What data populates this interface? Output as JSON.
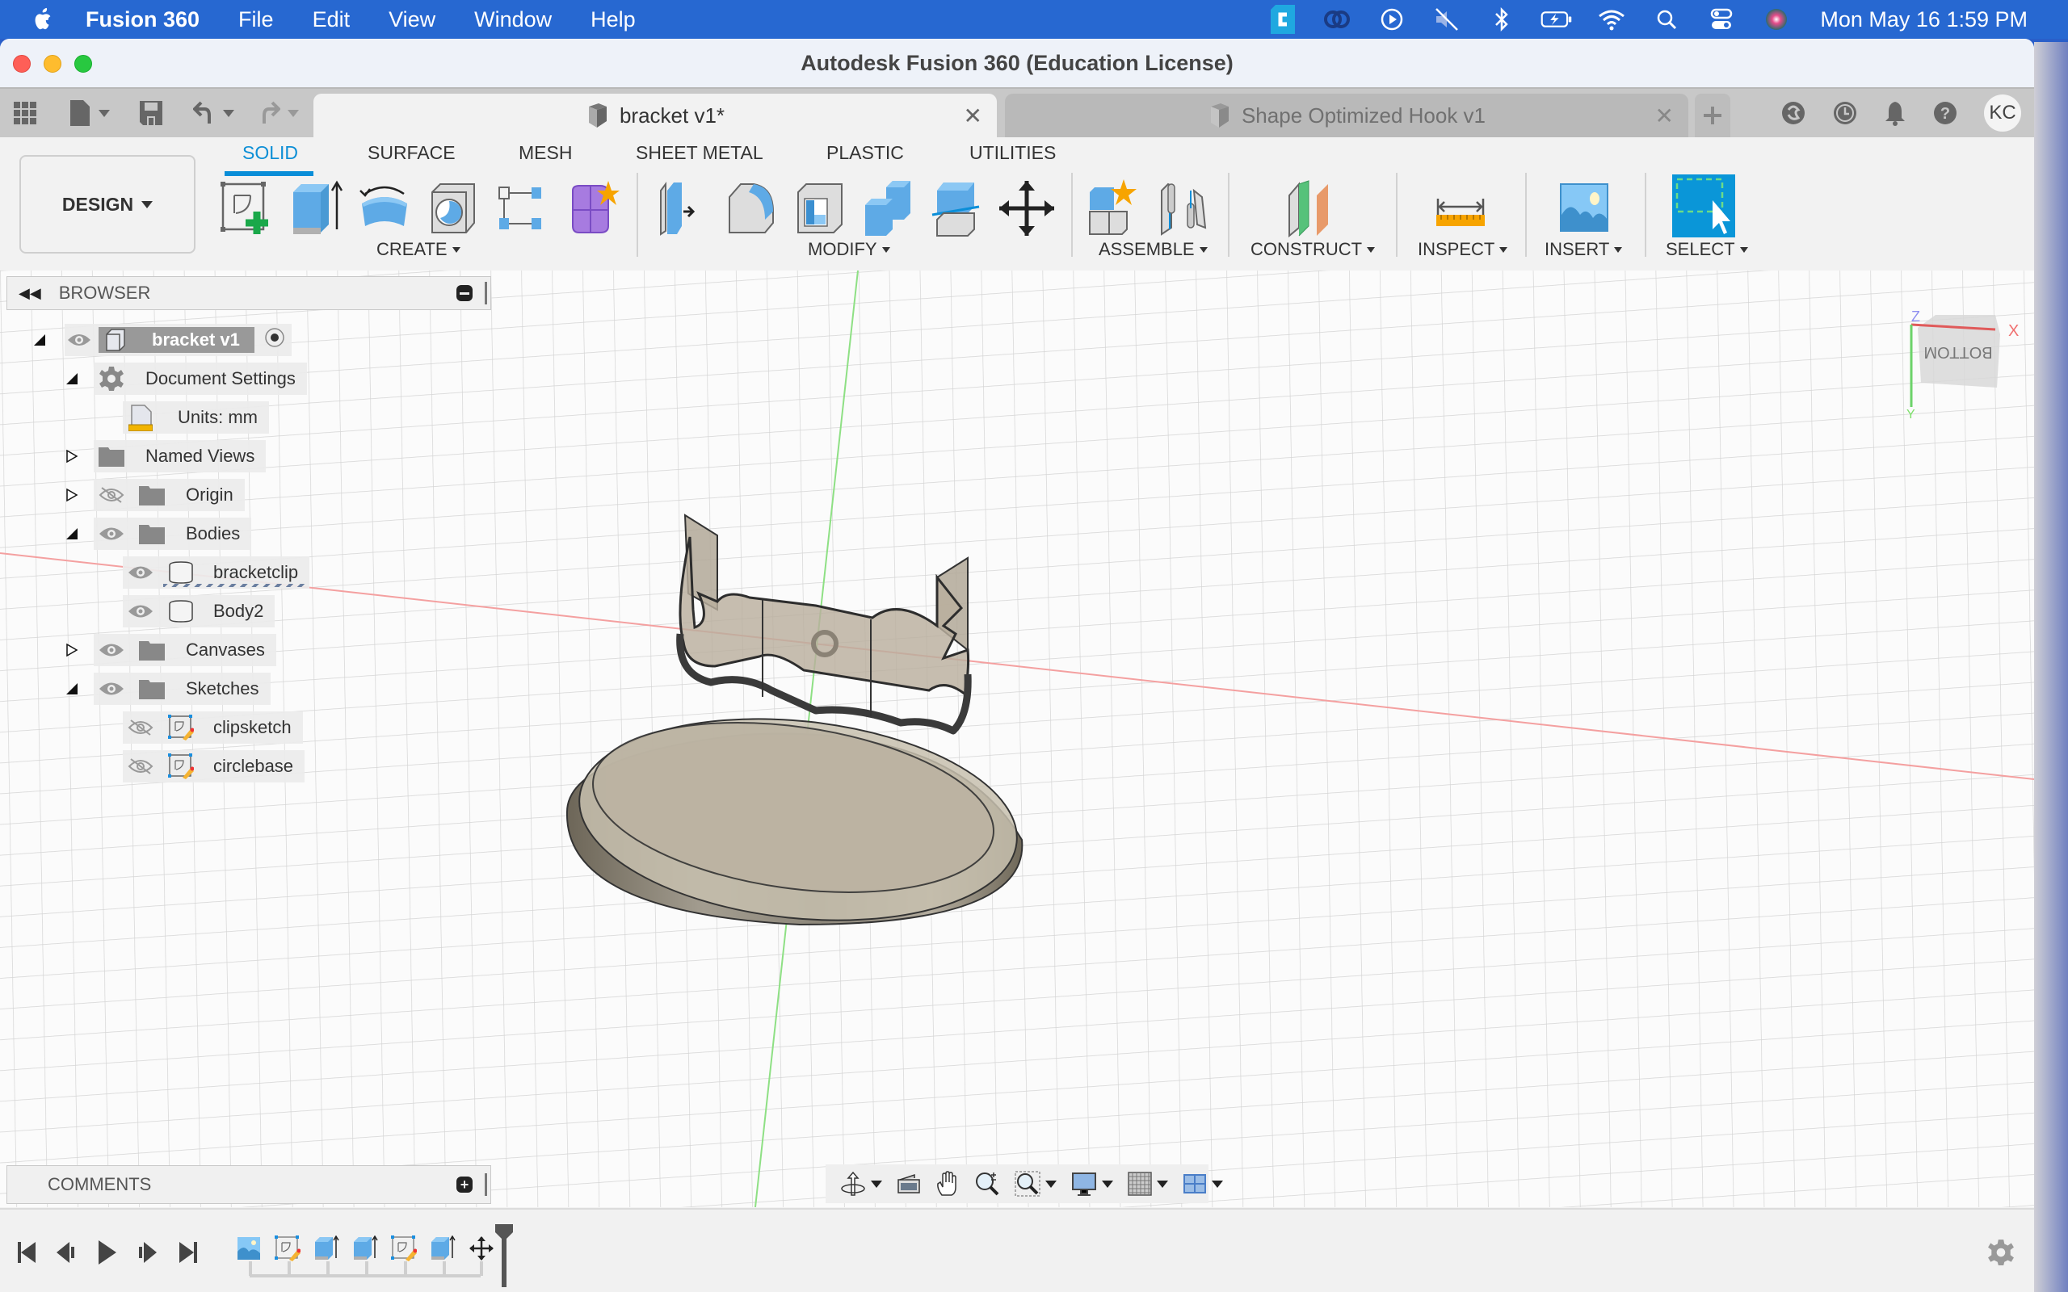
{
  "menubar": {
    "app_name": "Fusion 360",
    "items": [
      "File",
      "Edit",
      "View",
      "Window",
      "Help"
    ],
    "status_icons": [
      "creative-cloud-c-icon",
      "adobe-cc-icon",
      "play-circle-icon",
      "muted-speaker-icon",
      "bluetooth-icon",
      "battery-charging-icon",
      "wifi-icon",
      "spotlight-search-icon",
      "control-center-icon",
      "siri-icon"
    ],
    "clock": "Mon May 16  1:59 PM"
  },
  "window": {
    "title": "Autodesk Fusion 360 (Education License)"
  },
  "tabs": [
    {
      "label": "bracket v1*",
      "active": true
    },
    {
      "label": "Shape Optimized Hook v1",
      "active": false
    }
  ],
  "user": {
    "initials": "KC"
  },
  "toolbar": {
    "workspace": "DESIGN",
    "workspace_tabs": [
      "SOLID",
      "SURFACE",
      "MESH",
      "SHEET METAL",
      "PLASTIC",
      "UTILITIES"
    ],
    "active_workspace_tab": "SOLID",
    "groups": [
      {
        "label": "CREATE",
        "tools": [
          "create-sketch",
          "extrude",
          "revolve",
          "hole",
          "pattern",
          "create-form"
        ]
      },
      {
        "label": "MODIFY",
        "tools": [
          "press-pull",
          "fillet",
          "shell",
          "combine",
          "split-body",
          "move-copy"
        ]
      },
      {
        "label": "ASSEMBLE",
        "tools": [
          "new-component",
          "joint"
        ]
      },
      {
        "label": "CONSTRUCT",
        "tools": [
          "offset-plane"
        ]
      },
      {
        "label": "INSPECT",
        "tools": [
          "measure"
        ]
      },
      {
        "label": "INSERT",
        "tools": [
          "insert-canvas"
        ]
      },
      {
        "label": "SELECT",
        "tools": [
          "window-select"
        ]
      }
    ]
  },
  "browser": {
    "title": "BROWSER",
    "root": "bracket v1",
    "items": [
      {
        "label": "Document Settings",
        "level": 1,
        "expanded": true,
        "icon": "gear",
        "visible": null
      },
      {
        "label": "Units: mm",
        "level": 2,
        "icon": "units",
        "visible": null
      },
      {
        "label": "Named Views",
        "level": 1,
        "expanded": false,
        "icon": "folder",
        "visible": null
      },
      {
        "label": "Origin",
        "level": 1,
        "expanded": false,
        "icon": "folder",
        "visible": false
      },
      {
        "label": "Bodies",
        "level": 1,
        "expanded": true,
        "icon": "folder",
        "visible": true
      },
      {
        "label": "bracketclip",
        "level": 2,
        "icon": "body",
        "visible": true,
        "selected_hint": true
      },
      {
        "label": "Body2",
        "level": 2,
        "icon": "body",
        "visible": true
      },
      {
        "label": "Canvases",
        "level": 1,
        "expanded": false,
        "icon": "folder",
        "visible": true
      },
      {
        "label": "Sketches",
        "level": 1,
        "expanded": true,
        "icon": "folder",
        "visible": true
      },
      {
        "label": "clipsketch",
        "level": 2,
        "icon": "sketch",
        "visible": false
      },
      {
        "label": "circlebase",
        "level": 2,
        "icon": "sketch",
        "visible": false
      }
    ]
  },
  "comments": {
    "title": "COMMENTS"
  },
  "viewcube": {
    "face": "BOTTOM",
    "axes": [
      "X",
      "Y",
      "Z"
    ]
  },
  "navbar": {
    "tools": [
      "orbit",
      "look-at",
      "pan",
      "zoom",
      "fit-window",
      "display-settings",
      "grid-snap",
      "viewports"
    ]
  },
  "timeline": {
    "controls": [
      "go-to-start",
      "step-back",
      "play",
      "step-forward",
      "go-to-end"
    ],
    "features": [
      "canvas",
      "sketch",
      "extrude",
      "extrude",
      "sketch",
      "extrude",
      "move"
    ]
  },
  "colors": {
    "menubar": "#2768d1",
    "accent": "#0a8ed8",
    "x_axis": "#f08080",
    "y_axis": "#7ddf6a"
  }
}
